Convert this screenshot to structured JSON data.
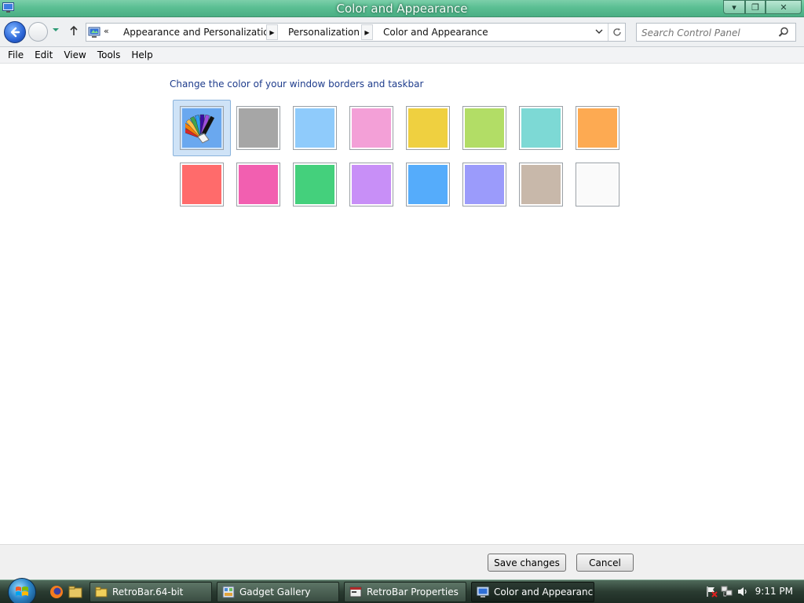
{
  "window": {
    "title": "Color and Appearance",
    "min_glyph": "▾",
    "max_glyph": "❐",
    "close_glyph": "✕"
  },
  "navbar": {
    "overflow_chevron": "«",
    "breadcrumbs": [
      "Appearance and Personalization",
      "Personalization",
      "Color and Appearance"
    ],
    "search_placeholder": "Search Control Panel"
  },
  "menu": [
    "File",
    "Edit",
    "View",
    "Tools",
    "Help"
  ],
  "main": {
    "heading": "Change the color of your window borders and taskbar",
    "swatches": [
      {
        "name": "custom",
        "color": "#6aa8ef",
        "selected": true
      },
      {
        "name": "gray",
        "color": "#a6a6a6"
      },
      {
        "name": "sky",
        "color": "#8fcbfb"
      },
      {
        "name": "pink",
        "color": "#f3a0d7"
      },
      {
        "name": "yellow",
        "color": "#efd040"
      },
      {
        "name": "lime",
        "color": "#b2dd66"
      },
      {
        "name": "teal",
        "color": "#7dd9d5"
      },
      {
        "name": "orange",
        "color": "#fdaa52"
      },
      {
        "name": "red",
        "color": "#ff6b6b"
      },
      {
        "name": "magenta",
        "color": "#f25fb0"
      },
      {
        "name": "green",
        "color": "#44d07c"
      },
      {
        "name": "violet",
        "color": "#c88ff7"
      },
      {
        "name": "blue",
        "color": "#55acfb"
      },
      {
        "name": "periwinkle",
        "color": "#9b9bfb"
      },
      {
        "name": "taupe",
        "color": "#c8b8aa"
      },
      {
        "name": "white",
        "color": "#fafafa"
      }
    ]
  },
  "footer": {
    "save_label": "Save changes",
    "cancel_label": "Cancel"
  },
  "taskbar": {
    "tasks": [
      {
        "label": "RetroBar.64-bit",
        "icon": "folder-icon"
      },
      {
        "label": "Gadget Gallery",
        "icon": "gadget-icon"
      },
      {
        "label": "RetroBar Properties",
        "icon": "properties-icon"
      },
      {
        "label": "Color and Appearance",
        "icon": "control-panel-icon",
        "active": true
      }
    ],
    "clock": "9:11 PM"
  }
}
